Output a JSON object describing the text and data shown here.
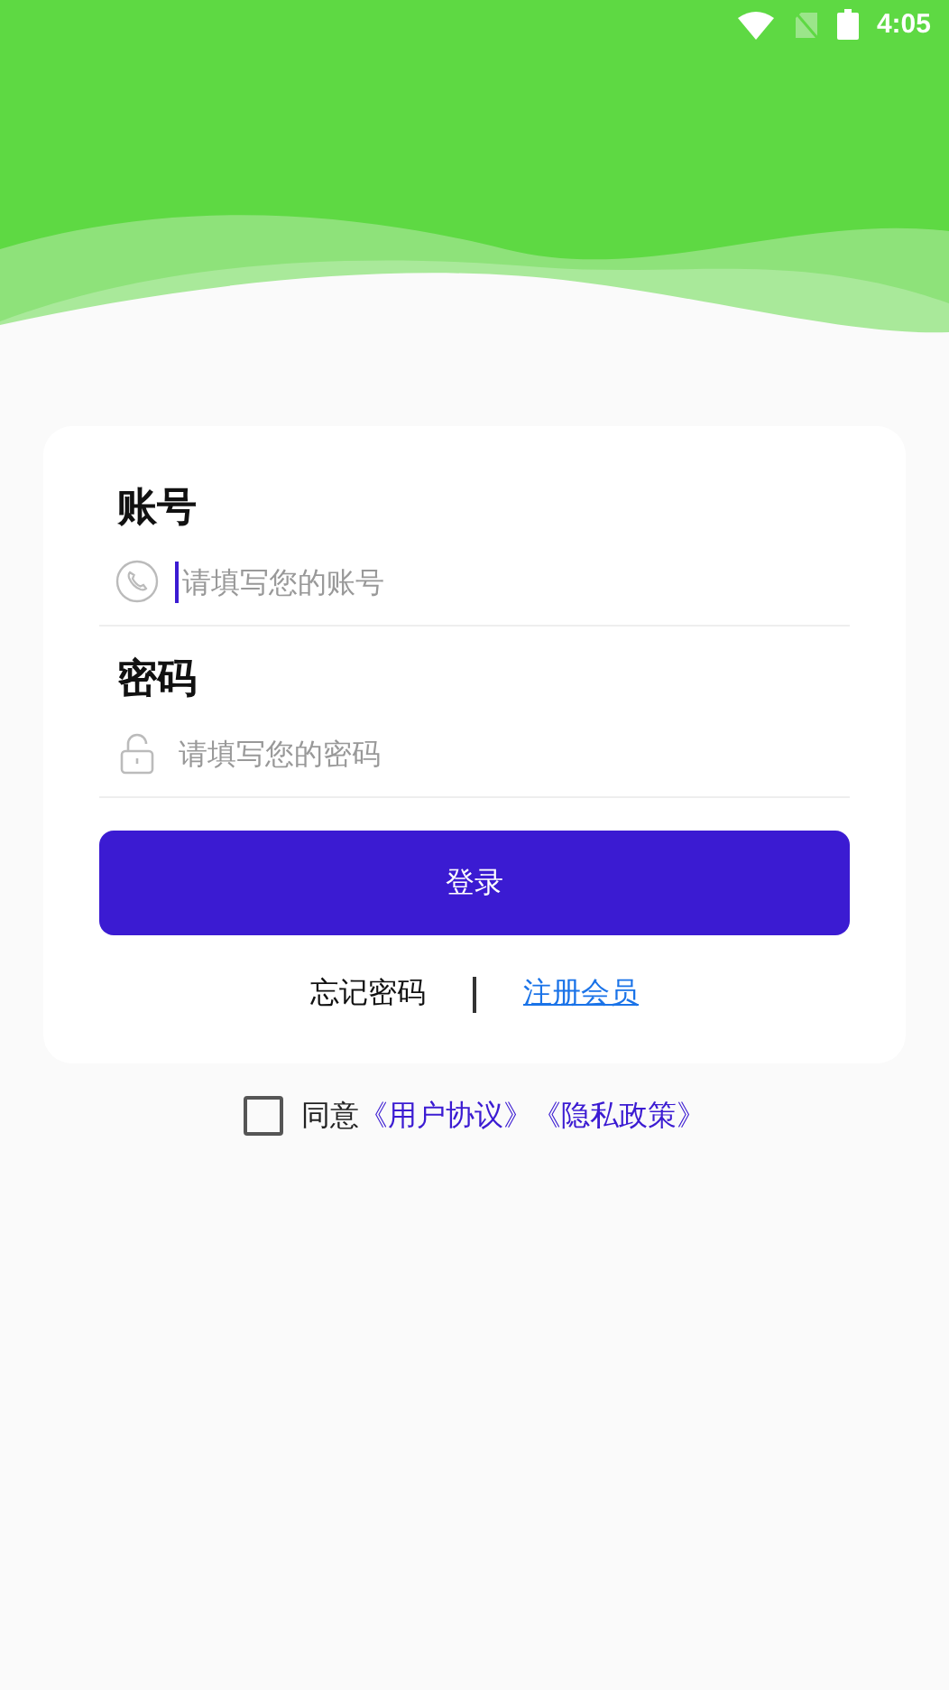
{
  "status_bar": {
    "time": "4:05"
  },
  "fields": [
    {
      "kind": "phone",
      "label": "账号",
      "placeholder": "请填写您的账号",
      "focused": true
    },
    {
      "kind": "lock",
      "label": "密码",
      "placeholder": "请填写您的密码",
      "focused": false
    }
  ],
  "login_button": "登录",
  "links": {
    "forgot": "忘记密码",
    "register": "注册会员"
  },
  "agreement": {
    "checked": false,
    "prefix": "同意",
    "terms": "《用户协议》",
    "privacy": "《隐私政策》"
  }
}
